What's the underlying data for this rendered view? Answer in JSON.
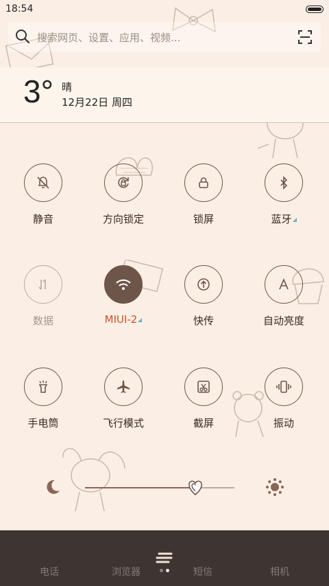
{
  "status_bar": {
    "time": "18:54"
  },
  "search": {
    "placeholder": "搜索网页、设置、应用、视频..."
  },
  "weather": {
    "temperature": "3°",
    "condition": "晴",
    "date": "12月22日 周四"
  },
  "toggles": [
    {
      "label": "静音",
      "icon": "bell-off-icon",
      "state": "off"
    },
    {
      "label": "方向锁定",
      "icon": "rotation-lock-icon",
      "state": "off"
    },
    {
      "label": "锁屏",
      "icon": "lock-icon",
      "state": "off"
    },
    {
      "label": "蓝牙",
      "icon": "bluetooth-icon",
      "state": "off",
      "has_more": true
    },
    {
      "label": "数据",
      "icon": "mobile-data-icon",
      "state": "disabled"
    },
    {
      "label": "MIUI-2",
      "icon": "wifi-icon",
      "state": "on",
      "has_more": true
    },
    {
      "label": "快传",
      "icon": "quick-transfer-icon",
      "state": "off"
    },
    {
      "label": "自动亮度",
      "icon": "auto-brightness-icon",
      "state": "off"
    },
    {
      "label": "手电筒",
      "icon": "flashlight-icon",
      "state": "off"
    },
    {
      "label": "飞行模式",
      "icon": "airplane-icon",
      "state": "off"
    },
    {
      "label": "截屏",
      "icon": "screenshot-icon",
      "state": "off"
    },
    {
      "label": "振动",
      "icon": "vibrate-icon",
      "state": "off"
    }
  ],
  "brightness": {
    "level_percent": 74
  },
  "dock": {
    "items": [
      "电话",
      "浏览器",
      "短信",
      "相机"
    ]
  },
  "colors": {
    "accent": "#6e5549",
    "active_label": "#d0502d",
    "background": "#fbeee4",
    "dock": "#3c3532"
  }
}
